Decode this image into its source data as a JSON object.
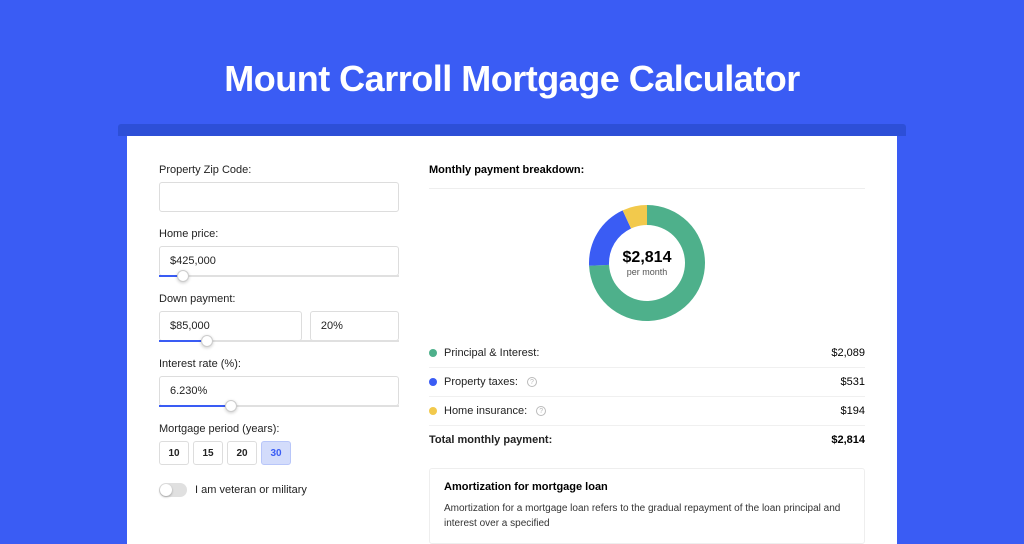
{
  "page": {
    "title": "Mount Carroll Mortgage Calculator"
  },
  "form": {
    "zip": {
      "label": "Property Zip Code:",
      "value": ""
    },
    "price": {
      "label": "Home price:",
      "value": "$425,000",
      "slider_pct": 10
    },
    "down": {
      "label": "Down payment:",
      "amount": "$85,000",
      "percent": "20%",
      "slider_pct": 20
    },
    "rate": {
      "label": "Interest rate (%):",
      "value": "6.230%",
      "slider_pct": 30
    },
    "period": {
      "label": "Mortgage period (years):",
      "options": [
        "10",
        "15",
        "20",
        "30"
      ],
      "selected": "30"
    },
    "veteran": {
      "label": "I am veteran or military",
      "checked": false
    }
  },
  "breakdown": {
    "title": "Monthly payment breakdown:",
    "donut": {
      "amount": "$2,814",
      "sub": "per month"
    },
    "items": [
      {
        "color": "#4eb08b",
        "label": "Principal & Interest:",
        "value": "$2,089",
        "info": false
      },
      {
        "color": "#3a5cf4",
        "label": "Property taxes:",
        "value": "$531",
        "info": true
      },
      {
        "color": "#f2c94c",
        "label": "Home insurance:",
        "value": "$194",
        "info": true
      }
    ],
    "total": {
      "label": "Total monthly payment:",
      "value": "$2,814"
    }
  },
  "chart_data": {
    "type": "pie",
    "title": "Monthly payment breakdown",
    "series": [
      {
        "name": "Principal & Interest",
        "value": 2089,
        "color": "#4eb08b"
      },
      {
        "name": "Property taxes",
        "value": 531,
        "color": "#3a5cf4"
      },
      {
        "name": "Home insurance",
        "value": 194,
        "color": "#f2c94c"
      }
    ],
    "total": 2814
  },
  "amortization": {
    "title": "Amortization for mortgage loan",
    "text": "Amortization for a mortgage loan refers to the gradual repayment of the loan principal and interest over a specified"
  }
}
